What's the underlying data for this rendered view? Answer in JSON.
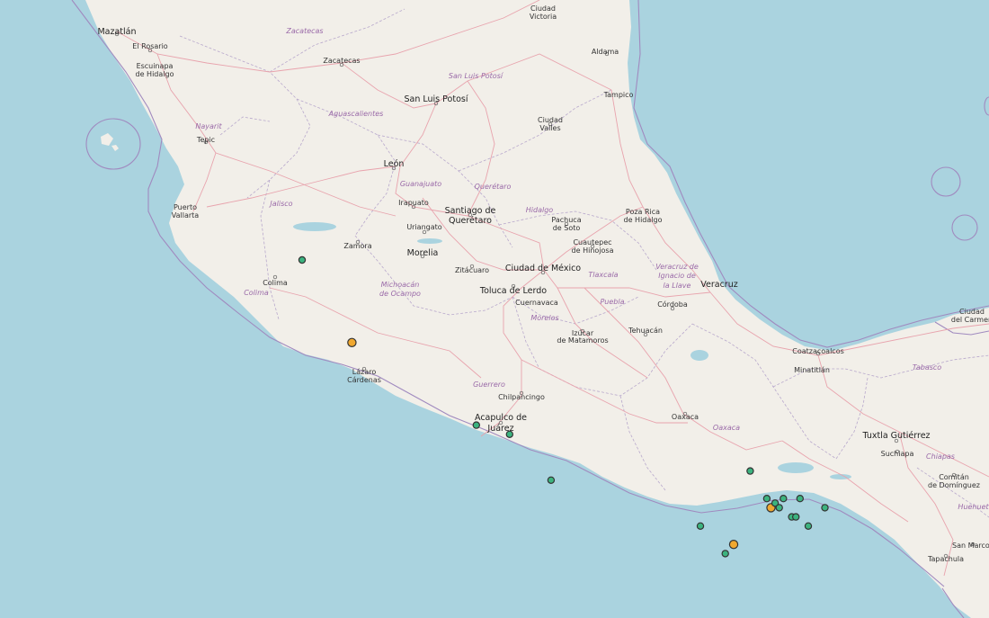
{
  "map": {
    "colors": {
      "water": "#aad3df",
      "land": "#f2efe9",
      "road": "#e8a3ad",
      "boundary": "#a08abf",
      "marker_green": "#3cb37f",
      "marker_orange": "#f0a830"
    },
    "cities": [
      {
        "name": "Mazatlán",
        "big": true
      },
      {
        "name": "El Rosario"
      },
      {
        "name": "Escuinapa"
      },
      {
        "name": "de Hidalgo"
      },
      {
        "name": "Tepic"
      },
      {
        "name": "Puerto"
      },
      {
        "name": "Vallarta"
      },
      {
        "name": "Zacatecas"
      },
      {
        "name": "Ciudad"
      },
      {
        "name": "Victoria"
      },
      {
        "name": "Aldama"
      },
      {
        "name": "Tampico"
      },
      {
        "name": "San Luis Potosí",
        "big": true
      },
      {
        "name": "Ciudad"
      },
      {
        "name": "Valles"
      },
      {
        "name": "León",
        "big": true
      },
      {
        "name": "Irapuato"
      },
      {
        "name": "Santiago de",
        "big": true
      },
      {
        "name": "Querétaro",
        "big": true
      },
      {
        "name": "Uriangato"
      },
      {
        "name": "Zamora"
      },
      {
        "name": "Morelia",
        "big": true
      },
      {
        "name": "Colima"
      },
      {
        "name": "Pachuca"
      },
      {
        "name": "de Soto"
      },
      {
        "name": "Poza Rica"
      },
      {
        "name": "de Hidalgo"
      },
      {
        "name": "Cuautepec"
      },
      {
        "name": "de Hinojosa"
      },
      {
        "name": "Zitácuaro"
      },
      {
        "name": "Ciudad de México",
        "big": true
      },
      {
        "name": "Toluca de Lerdo",
        "big": true
      },
      {
        "name": "Cuernavaca"
      },
      {
        "name": "Veracruz",
        "big": true
      },
      {
        "name": "Córdoba"
      },
      {
        "name": "Tehuacán"
      },
      {
        "name": "Izúcar"
      },
      {
        "name": "de Matamoros"
      },
      {
        "name": "Lázaro"
      },
      {
        "name": "Cárdenas"
      },
      {
        "name": "Chilpancingo"
      },
      {
        "name": "Acapulco de",
        "big": true
      },
      {
        "name": "Juárez",
        "big": true
      },
      {
        "name": "Oaxaca"
      },
      {
        "name": "Coatzacoalcos"
      },
      {
        "name": "Minatitlán"
      },
      {
        "name": "Ciudad"
      },
      {
        "name": "del Carmen"
      },
      {
        "name": "Tuxtla Gutiérrez",
        "big": true
      },
      {
        "name": "Suchiapa"
      },
      {
        "name": "Comitán"
      },
      {
        "name": "de Domínguez"
      },
      {
        "name": "San Marcos"
      },
      {
        "name": "Tapachula"
      }
    ],
    "states": [
      "Zacatecas",
      "San Luis Potosí",
      "Aguascalientes",
      "Nayarit",
      "Guanajuato",
      "Querétaro",
      "Jalisco",
      "Hidalgo",
      "Colima",
      "Michoacán",
      "de Ocampo",
      "Tlaxcala",
      "Veracruz de",
      "Ignacio de",
      "la Llave",
      "Puebla",
      "Morelos",
      "Guerrero",
      "Oaxaca",
      "Tabasco",
      "Chiapas",
      "Huehuete"
    ],
    "quakes": [
      {
        "lat": 19.1,
        "lon": -103.9,
        "type": "green"
      },
      {
        "lat": 18.2,
        "lon": -103.3,
        "type": "orange"
      },
      {
        "lat": 17.3,
        "lon": -101.8,
        "type": "green"
      },
      {
        "lat": 17.2,
        "lon": -101.4,
        "type": "green"
      },
      {
        "lat": 16.7,
        "lon": -100.9,
        "type": "green"
      },
      {
        "lat": 16.8,
        "lon": -98.5,
        "type": "green"
      },
      {
        "lat": 16.2,
        "lon": -99.1,
        "type": "green"
      },
      {
        "lat": 16.0,
        "lon": -98.7,
        "type": "orange"
      },
      {
        "lat": 15.9,
        "lon": -98.8,
        "type": "green"
      },
      {
        "lat": 16.5,
        "lon": -98.3,
        "type": "green"
      },
      {
        "lat": 16.4,
        "lon": -98.25,
        "type": "orange"
      },
      {
        "lat": 16.45,
        "lon": -98.2,
        "type": "green"
      },
      {
        "lat": 16.4,
        "lon": -98.15,
        "type": "green"
      },
      {
        "lat": 16.5,
        "lon": -98.1,
        "type": "green"
      },
      {
        "lat": 16.3,
        "lon": -98.0,
        "type": "green"
      },
      {
        "lat": 16.3,
        "lon": -97.95,
        "type": "green"
      },
      {
        "lat": 16.2,
        "lon": -97.8,
        "type": "green"
      },
      {
        "lat": 16.5,
        "lon": -97.9,
        "type": "green"
      },
      {
        "lat": 16.4,
        "lon": -97.6,
        "type": "green"
      },
      {
        "lat": 17.2,
        "lon": -95.5,
        "type": "green"
      },
      {
        "lat": 16.7,
        "lon": -95.4,
        "type": "green"
      },
      {
        "lat": 16.7,
        "lon": -95.35,
        "type": "green"
      },
      {
        "lat": 16.9,
        "lon": -95.1,
        "type": "green"
      },
      {
        "lat": 16.9,
        "lon": -95.0,
        "type": "green"
      },
      {
        "lat": 16.4,
        "lon": -95.5,
        "type": "green"
      },
      {
        "lat": 16.35,
        "lon": -95.4,
        "type": "green"
      },
      {
        "lat": 16.2,
        "lon": -95.35,
        "type": "green"
      },
      {
        "lat": 15.7,
        "lon": -95.2,
        "type": "orange"
      },
      {
        "lat": 15.6,
        "lon": -95.1,
        "type": "green"
      },
      {
        "lat": 15.5,
        "lon": -95.1,
        "type": "green"
      },
      {
        "lat": 15.5,
        "lon": -95.0,
        "type": "green"
      },
      {
        "lat": 15.3,
        "lon": -94.7,
        "type": "green"
      },
      {
        "lat": 17.5,
        "lon": -95.2,
        "type": "orange"
      },
      {
        "lat": 17.3,
        "lon": -94.2,
        "type": "orange"
      },
      {
        "lat": 18.0,
        "lon": -94.9,
        "type": "green"
      },
      {
        "lat": 15.5,
        "lon": -93.6,
        "type": "green"
      },
      {
        "lat": 15.2,
        "lon": -93.3,
        "type": "green"
      }
    ]
  }
}
